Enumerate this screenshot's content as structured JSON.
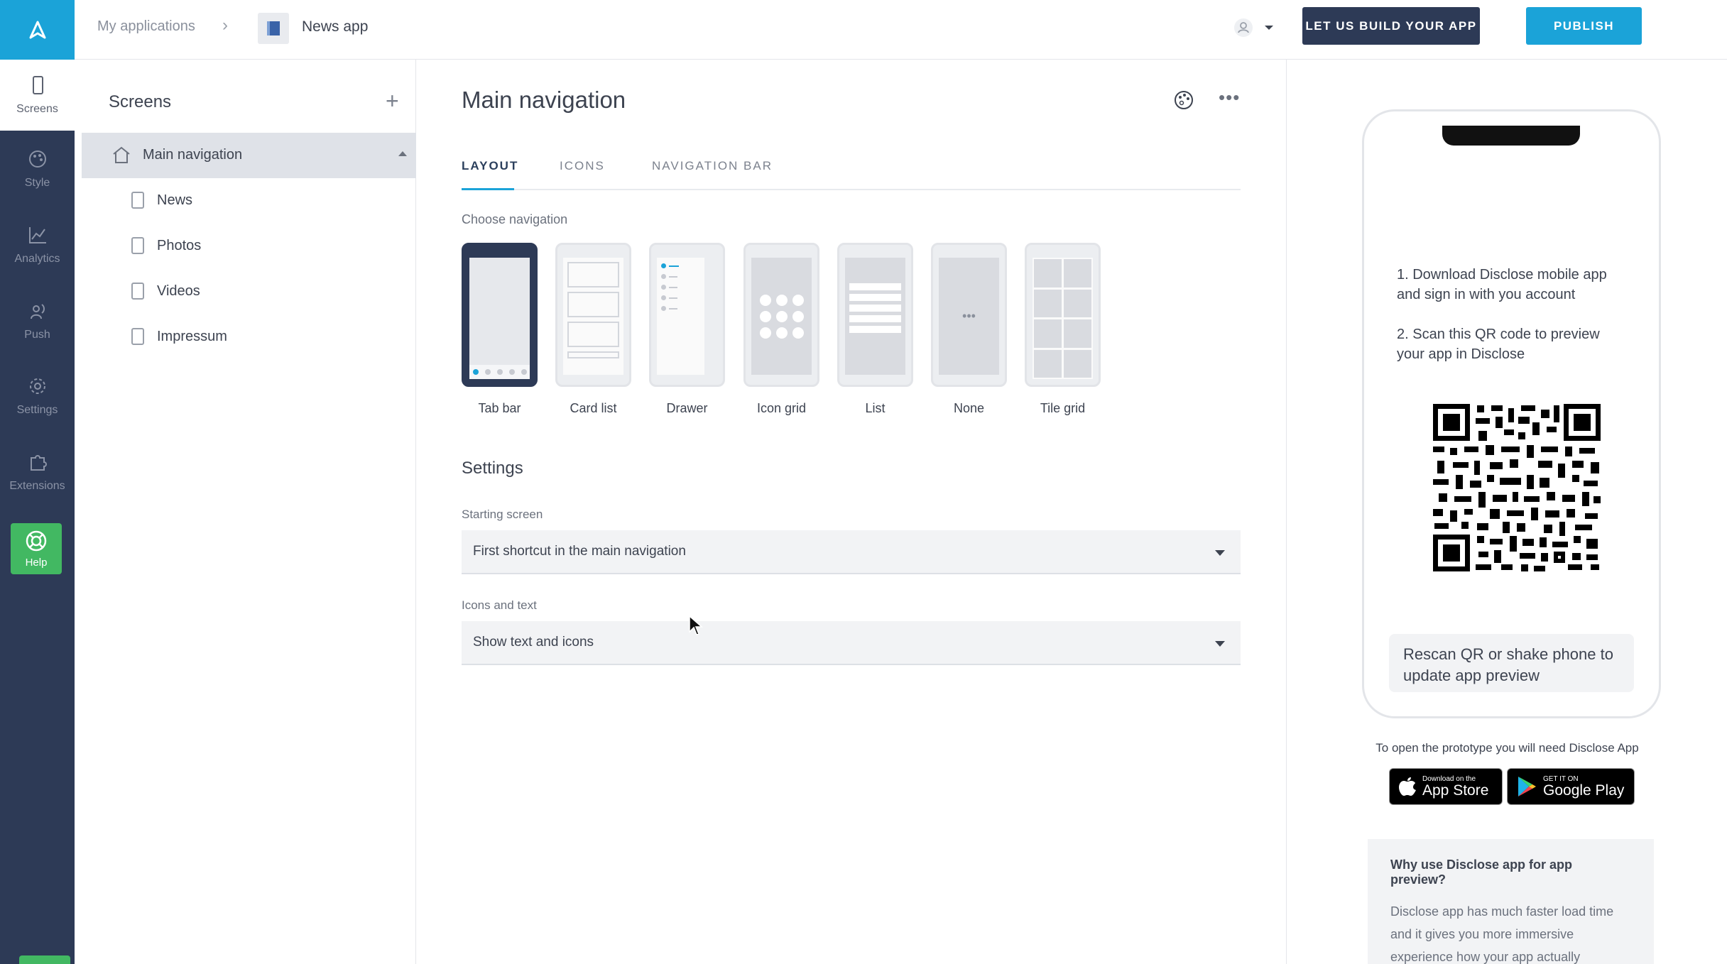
{
  "rail": {
    "items": [
      {
        "label": "Screens",
        "icon": "phone-icon"
      },
      {
        "label": "Style",
        "icon": "palette-icon"
      },
      {
        "label": "Analytics",
        "icon": "chart-icon"
      },
      {
        "label": "Push",
        "icon": "broadcast-icon"
      },
      {
        "label": "Settings",
        "icon": "gear-icon"
      },
      {
        "label": "Extensions",
        "icon": "puzzle-icon"
      }
    ],
    "help_label": "Help"
  },
  "header": {
    "breadcrumb_root": "My applications",
    "app_name": "News app",
    "build_button": "LET US BUILD YOUR APP",
    "publish_button": "PUBLISH"
  },
  "screens_panel": {
    "title": "Screens",
    "main_item": "Main navigation",
    "children": [
      "News",
      "Photos",
      "Videos",
      "Impressum"
    ]
  },
  "main": {
    "title": "Main navigation",
    "tabs": [
      "LAYOUT",
      "ICONS",
      "NAVIGATION BAR"
    ],
    "active_tab": "LAYOUT",
    "choose_label": "Choose navigation",
    "nav_options": [
      "Tab bar",
      "Card list",
      "Drawer",
      "Icon grid",
      "List",
      "None",
      "Tile grid"
    ],
    "selected_option": "Tab bar",
    "settings_title": "Settings",
    "starting_screen_label": "Starting screen",
    "starting_screen_value": "First shortcut in the main navigation",
    "icons_text_label": "Icons and text",
    "icons_text_value": "Show text and icons"
  },
  "preview": {
    "step1": "1. Download Disclose mobile app and sign in with you account",
    "step2": "2. Scan this QR code to preview your app in Disclose",
    "rescan": "Rescan QR or shake phone to update app preview",
    "need_app": "To open the prototype you will need Disclose App",
    "app_store_small": "Download on the",
    "app_store_big": "App Store",
    "google_play_small": "GET IT ON",
    "google_play_big": "Google Play",
    "why_title": "Why use Disclose app for app preview?",
    "why_text": "Disclose app has much faster load time and it gives you more immersive experience how your app actually"
  },
  "colors": {
    "rail_bg": "#2d3a56",
    "accent": "#1ba3d8",
    "help_green": "#42b862"
  }
}
